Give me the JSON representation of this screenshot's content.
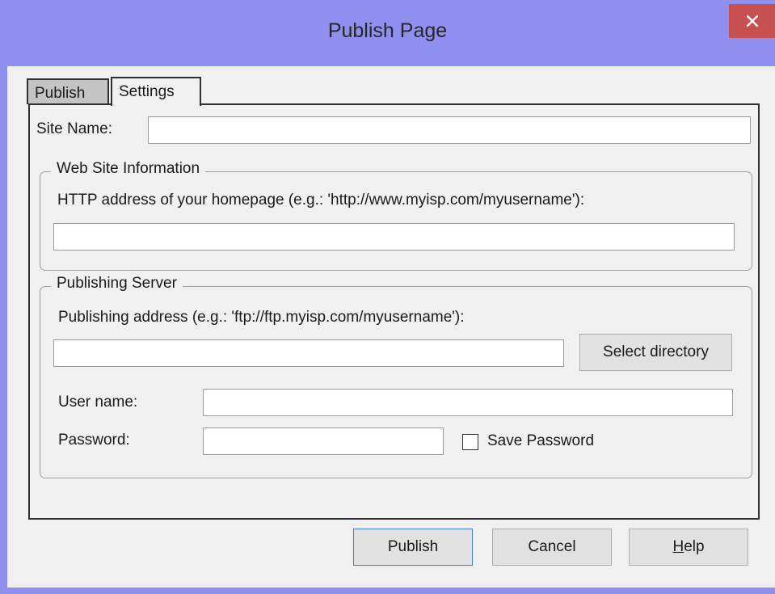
{
  "window": {
    "title": "Publish Page",
    "close_icon": "close-icon"
  },
  "tabs": [
    {
      "label": "Publish",
      "active": false
    },
    {
      "label": "Settings",
      "active": true
    }
  ],
  "settings": {
    "site_name_label": "Site Name:",
    "site_name_value": "",
    "web_site_info": {
      "legend": "Web Site Information",
      "http_label": "HTTP address of your homepage (e.g.: 'http://www.myisp.com/myusername'):",
      "http_value": ""
    },
    "publishing_server": {
      "legend": "Publishing Server",
      "address_label": "Publishing address (e.g.: 'ftp://ftp.myisp.com/myusername'):",
      "address_value": "",
      "select_directory_label": "Select directory",
      "username_label": "User name:",
      "username_value": "",
      "password_label": "Password:",
      "password_value": "",
      "save_password_label": "Save Password",
      "save_password_checked": false
    }
  },
  "buttons": {
    "publish": "Publish",
    "cancel": "Cancel",
    "help_mnemonic": "H",
    "help_rest": "elp"
  },
  "colors": {
    "titlebar": "#8f8fef",
    "close_button": "#c75050",
    "dialog_background": "#f0f0f0",
    "default_button_border": "#3c7fd1"
  }
}
